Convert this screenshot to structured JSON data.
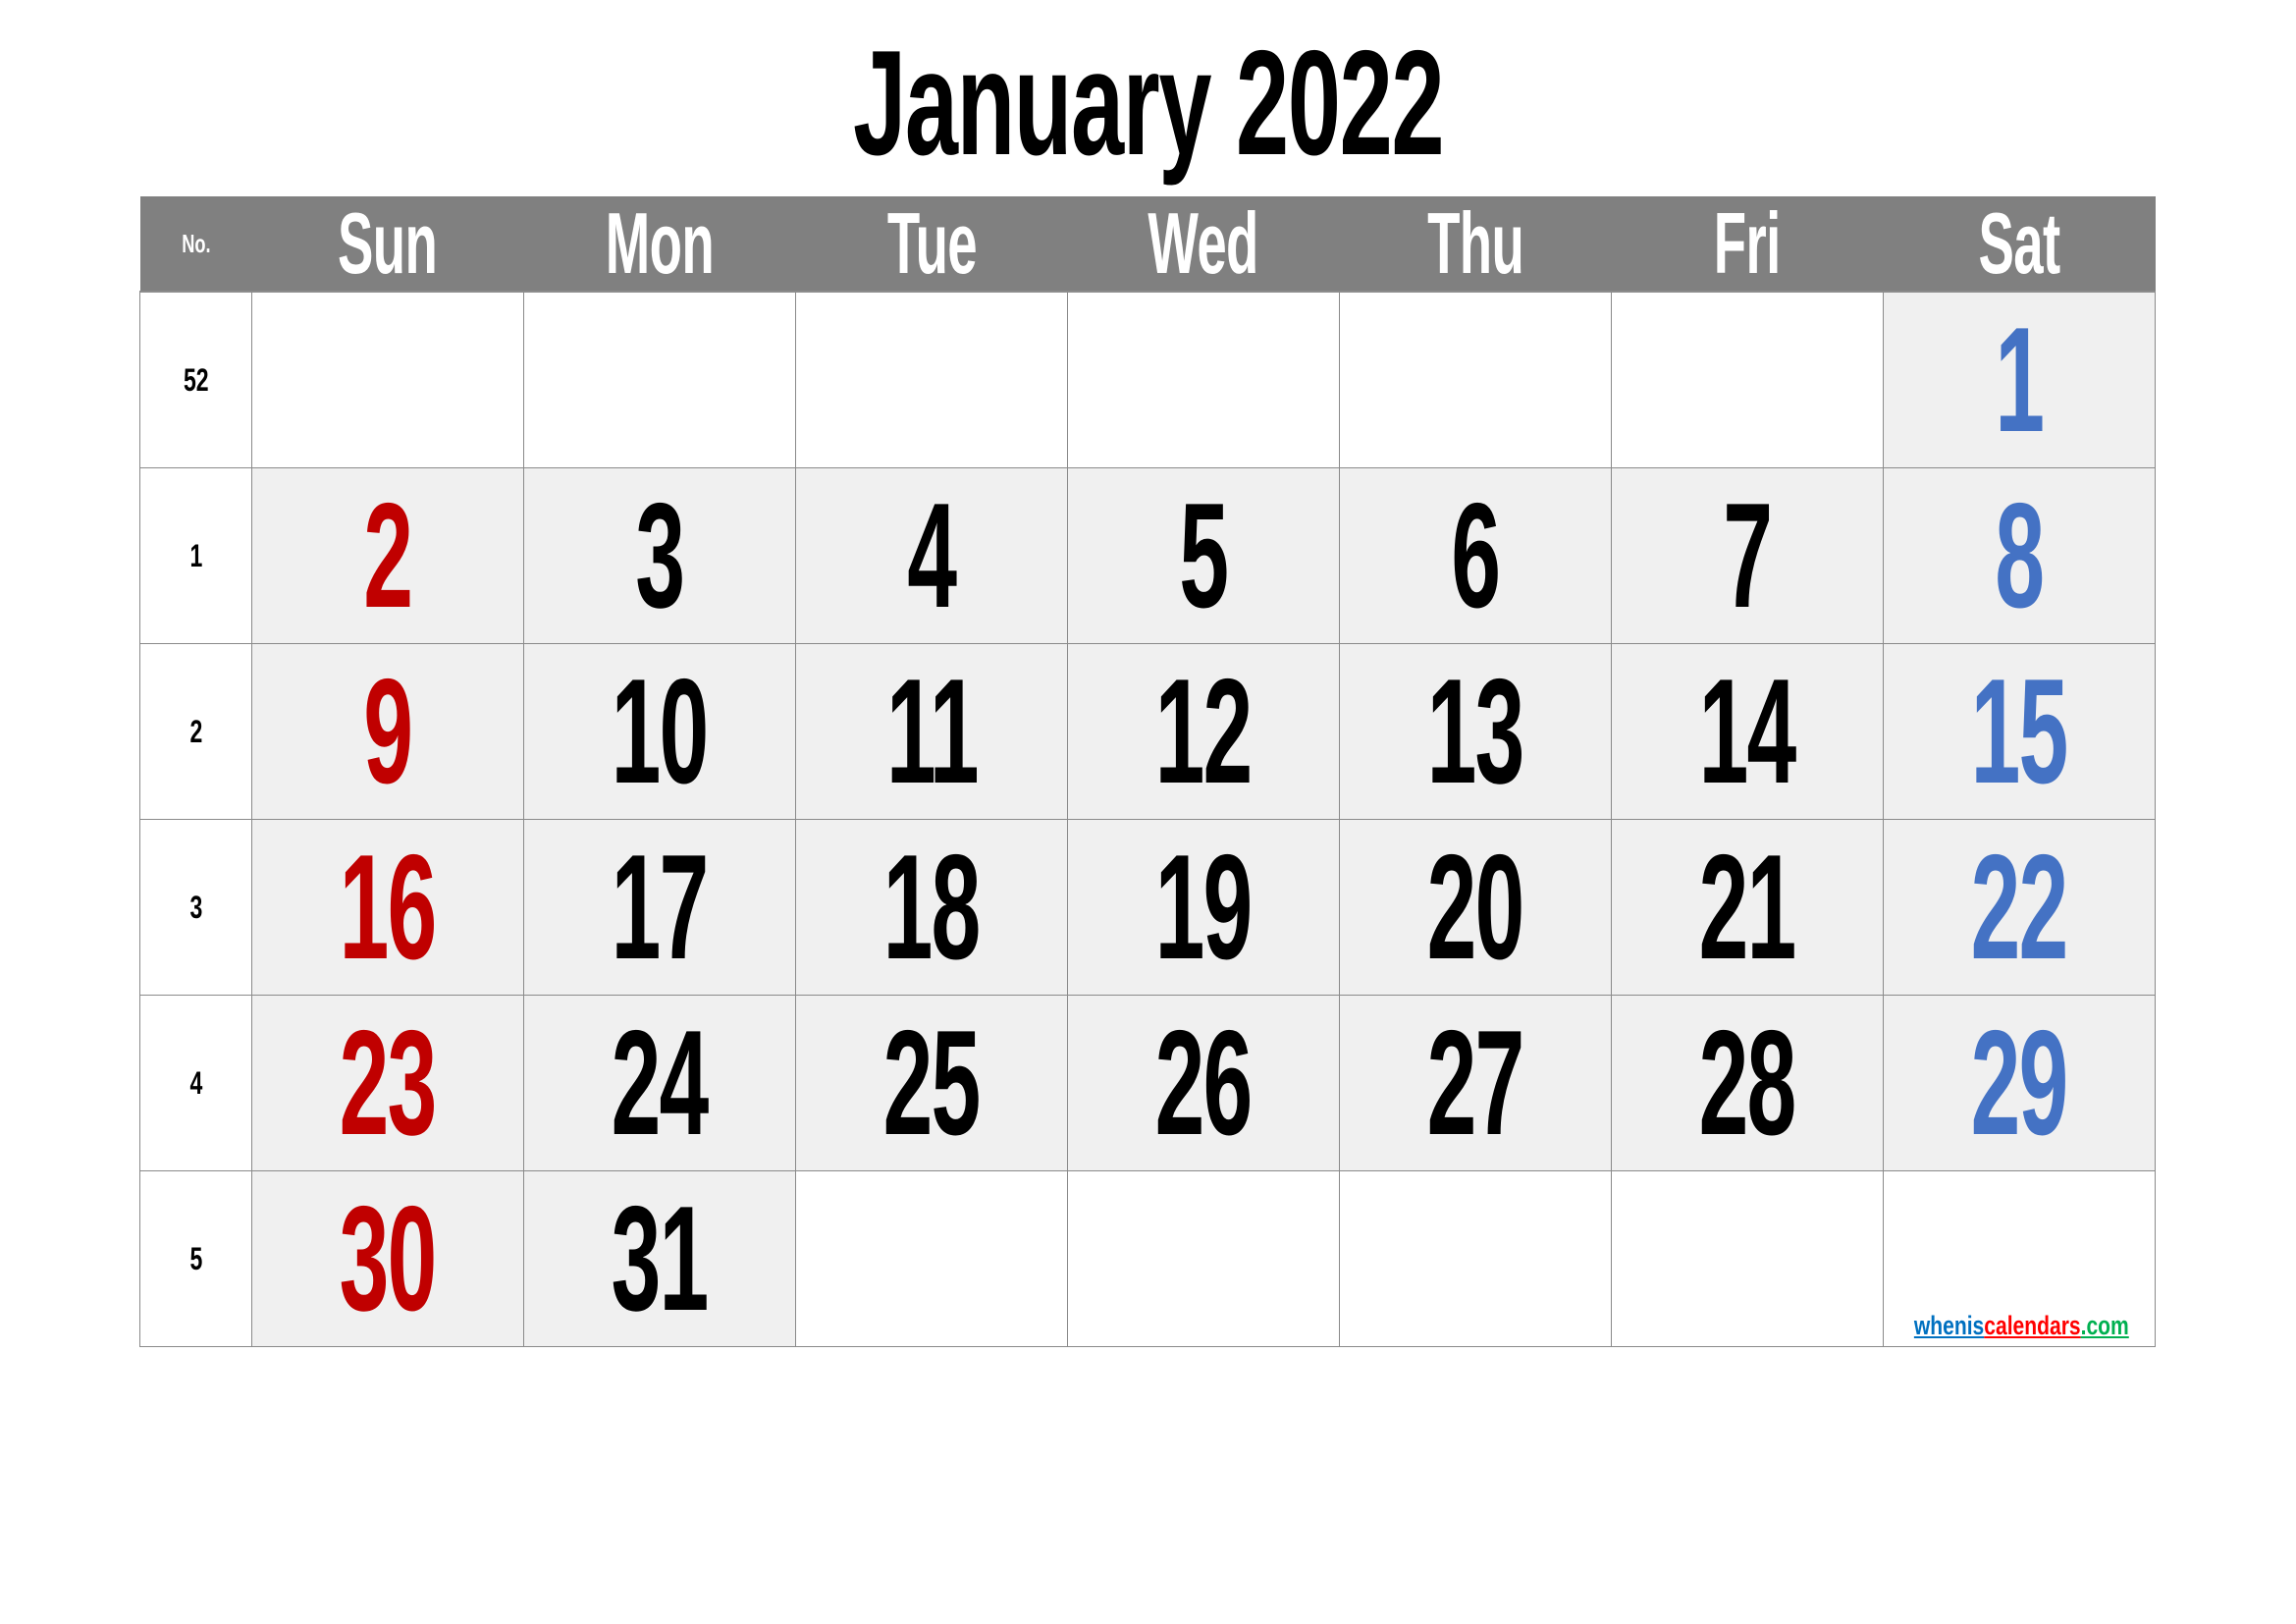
{
  "title": "January 2022",
  "header": {
    "week_label": "No.",
    "days": [
      "Sun",
      "Mon",
      "Tue",
      "Wed",
      "Thu",
      "Fri",
      "Sat"
    ]
  },
  "colors": {
    "header_bg": "#808080",
    "sunday": "#c00000",
    "weekday": "#000000",
    "saturday": "#4472c4",
    "filled_cell_bg": "#f0f0f0",
    "grid_line": "#8a8a8a"
  },
  "weeks": [
    {
      "no": "52",
      "days": [
        "",
        "",
        "",
        "",
        "",
        "",
        "1"
      ]
    },
    {
      "no": "1",
      "days": [
        "2",
        "3",
        "4",
        "5",
        "6",
        "7",
        "8"
      ]
    },
    {
      "no": "2",
      "days": [
        "9",
        "10",
        "11",
        "12",
        "13",
        "14",
        "15"
      ]
    },
    {
      "no": "3",
      "days": [
        "16",
        "17",
        "18",
        "19",
        "20",
        "21",
        "22"
      ]
    },
    {
      "no": "4",
      "days": [
        "23",
        "24",
        "25",
        "26",
        "27",
        "28",
        "29"
      ]
    },
    {
      "no": "5",
      "days": [
        "30",
        "31",
        "",
        "",
        "",
        "",
        ""
      ]
    }
  ],
  "watermark": {
    "part1": "whenis",
    "part2": "calendars",
    "part3": ".com"
  }
}
